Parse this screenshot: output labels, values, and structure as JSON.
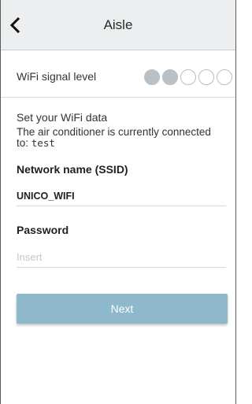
{
  "header": {
    "title": "Aisle",
    "back_icon": "chevron-left-icon"
  },
  "signal": {
    "label": "WiFi signal level",
    "level": 2,
    "max": 5,
    "filled_color": "#b9c0c6"
  },
  "setup": {
    "heading": "Set your WiFi data",
    "connected_text": "The air conditioner is currently connected to:",
    "connected_ssid": "test"
  },
  "form": {
    "ssid_label": "Network name (SSID)",
    "ssid_value": "UNICO_WIFI",
    "password_label": "Password",
    "password_value": "",
    "password_placeholder": "Insert"
  },
  "actions": {
    "next_label": "Next",
    "next_color": "#8eb8cc"
  }
}
